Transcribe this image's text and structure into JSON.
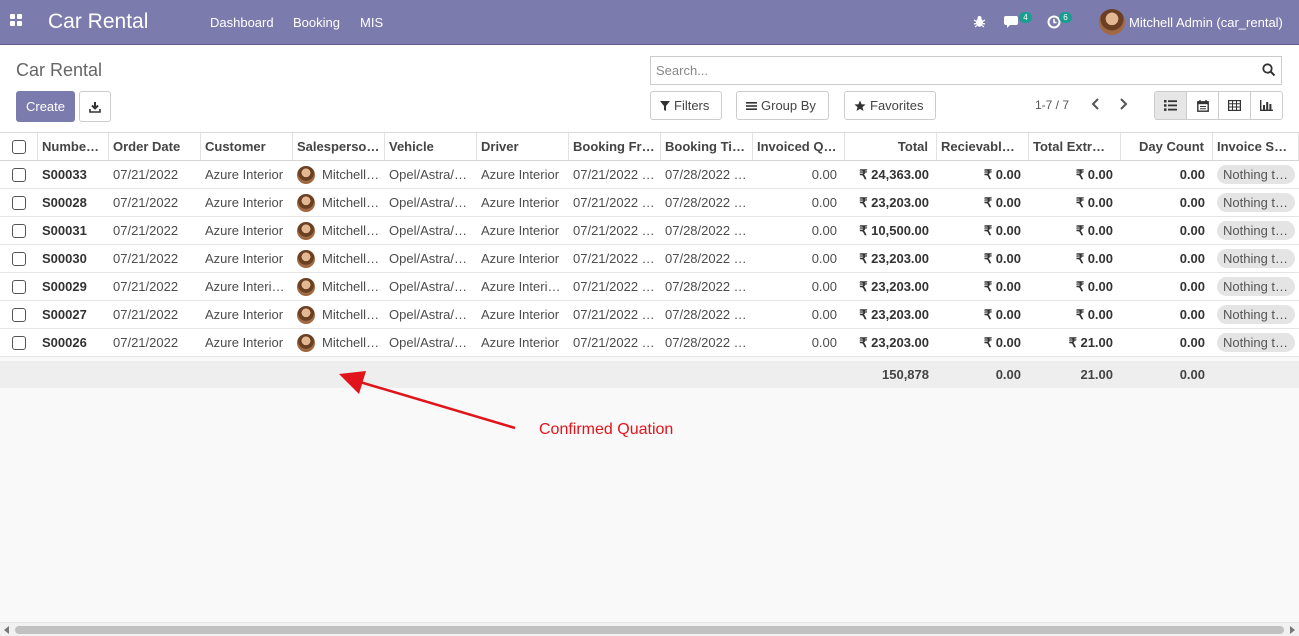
{
  "navbar": {
    "app_title": "Car Rental",
    "menu": [
      "Dashboard",
      "Booking",
      "MIS"
    ],
    "messages_count": "4",
    "activities_count": "6",
    "user_name": "Mitchell Admin (car_rental)",
    "bg_color": "#7c7bad"
  },
  "control_panel": {
    "title": "Car Rental",
    "create_label": "Create",
    "search_placeholder": "Search...",
    "filters_label": "Filters",
    "groupby_label": "Group By",
    "favorites_label": "Favorites",
    "pager": "1-7 / 7"
  },
  "table": {
    "columns": [
      "Numbe…",
      "Order Date",
      "Customer",
      "Salesperso…",
      "Vehicle",
      "Driver",
      "Booking Fr…",
      "Booking Til…",
      "Invoiced Q…",
      "Total",
      "Recievable…",
      "Total Extra …",
      "Day Count",
      "Invoice Sta…"
    ],
    "rows": [
      {
        "number": "S00033",
        "order_date": "07/21/2022",
        "customer": "Azure Interior",
        "salesperson": "Mitchell…",
        "vehicle": "Opel/Astra/…",
        "driver": "Azure Interior",
        "booking_from": "07/21/2022 …",
        "booking_till": "07/28/2022 …",
        "invoiced_qty": "0.00",
        "total": "₹ 24,363.00",
        "receivable": "₹ 0.00",
        "total_extra": "₹ 0.00",
        "day_count": "0.00",
        "invoice_status": "Nothing to …"
      },
      {
        "number": "S00028",
        "order_date": "07/21/2022",
        "customer": "Azure Interior",
        "salesperson": "Mitchell…",
        "vehicle": "Opel/Astra/…",
        "driver": "Azure Interior",
        "booking_from": "07/21/2022 …",
        "booking_till": "07/28/2022 …",
        "invoiced_qty": "0.00",
        "total": "₹ 23,203.00",
        "receivable": "₹ 0.00",
        "total_extra": "₹ 0.00",
        "day_count": "0.00",
        "invoice_status": "Nothing to …"
      },
      {
        "number": "S00031",
        "order_date": "07/21/2022",
        "customer": "Azure Interior",
        "salesperson": "Mitchell…",
        "vehicle": "Opel/Astra/…",
        "driver": "Azure Interior",
        "booking_from": "07/21/2022 …",
        "booking_till": "07/28/2022 …",
        "invoiced_qty": "0.00",
        "total": "₹ 10,500.00",
        "receivable": "₹ 0.00",
        "total_extra": "₹ 0.00",
        "day_count": "0.00",
        "invoice_status": "Nothing to …"
      },
      {
        "number": "S00030",
        "order_date": "07/21/2022",
        "customer": "Azure Interior",
        "salesperson": "Mitchell…",
        "vehicle": "Opel/Astra/…",
        "driver": "Azure Interior",
        "booking_from": "07/21/2022 …",
        "booking_till": "07/28/2022 …",
        "invoiced_qty": "0.00",
        "total": "₹ 23,203.00",
        "receivable": "₹ 0.00",
        "total_extra": "₹ 0.00",
        "day_count": "0.00",
        "invoice_status": "Nothing to …"
      },
      {
        "number": "S00029",
        "order_date": "07/21/2022",
        "customer": "Azure Interi…",
        "salesperson": "Mitchell…",
        "vehicle": "Opel/Astra/…",
        "driver": "Azure Interi…",
        "booking_from": "07/21/2022 …",
        "booking_till": "07/28/2022 …",
        "invoiced_qty": "0.00",
        "total": "₹ 23,203.00",
        "receivable": "₹ 0.00",
        "total_extra": "₹ 0.00",
        "day_count": "0.00",
        "invoice_status": "Nothing to …"
      },
      {
        "number": "S00027",
        "order_date": "07/21/2022",
        "customer": "Azure Interior",
        "salesperson": "Mitchell…",
        "vehicle": "Opel/Astra/…",
        "driver": "Azure Interior",
        "booking_from": "07/21/2022 …",
        "booking_till": "07/28/2022 …",
        "invoiced_qty": "0.00",
        "total": "₹ 23,203.00",
        "receivable": "₹ 0.00",
        "total_extra": "₹ 0.00",
        "day_count": "0.00",
        "invoice_status": "Nothing to …"
      },
      {
        "number": "S00026",
        "order_date": "07/21/2022",
        "customer": "Azure Interior",
        "salesperson": "Mitchell…",
        "vehicle": "Opel/Astra/…",
        "driver": "Azure Interior",
        "booking_from": "07/21/2022 …",
        "booking_till": "07/28/2022 …",
        "invoiced_qty": "0.00",
        "total": "₹ 23,203.00",
        "receivable": "₹ 0.00",
        "total_extra": "₹ 21.00",
        "day_count": "0.00",
        "invoice_status": "Nothing to …"
      }
    ],
    "totals": {
      "total": "150,878",
      "receivable": "0.00",
      "total_extra": "21.00",
      "day_count": "0.00"
    }
  },
  "annotation": {
    "text": "Confirmed Quation",
    "color": "#e2141b"
  }
}
